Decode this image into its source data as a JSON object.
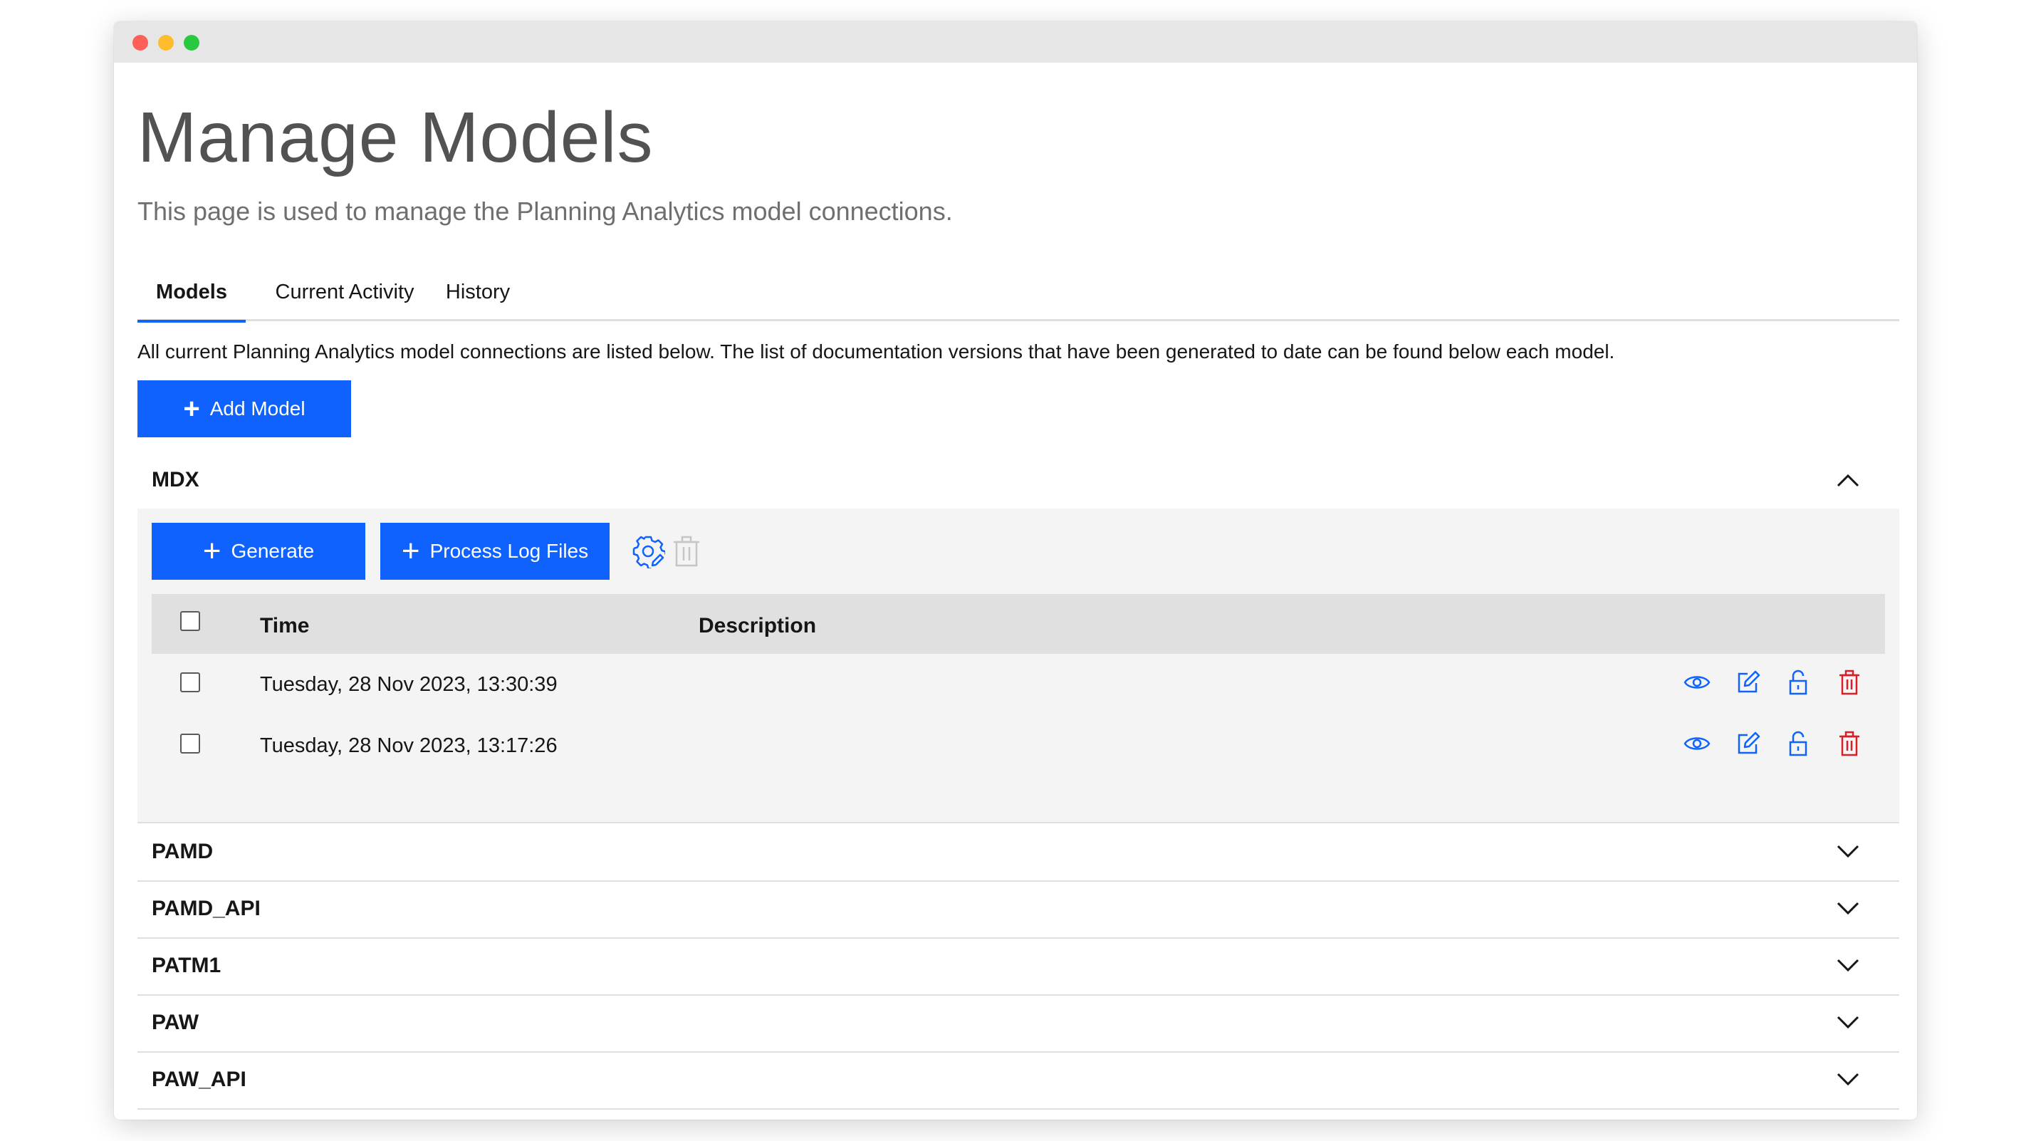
{
  "page": {
    "title": "Manage Models",
    "subtitle": "This page is used to manage the Planning Analytics model connections.",
    "intro": "All current Planning Analytics model connections are listed below. The list of documentation versions that have been generated to date can be found below each model."
  },
  "tabs": [
    {
      "label": "Models",
      "active": true
    },
    {
      "label": "Current Activity",
      "active": false
    },
    {
      "label": "History",
      "active": false
    }
  ],
  "buttons": {
    "add_model": "Add Model",
    "generate": "Generate",
    "process_log_files": "Process Log Files"
  },
  "models": [
    {
      "name": "MDX",
      "expanded": true,
      "table": {
        "headers": {
          "time": "Time",
          "description": "Description"
        },
        "rows": [
          {
            "time": "Tuesday, 28 Nov 2023, 13:30:39",
            "description": ""
          },
          {
            "time": "Tuesday, 28 Nov 2023, 13:17:26",
            "description": ""
          }
        ],
        "row_actions": [
          "eye-icon",
          "edit-icon",
          "unlock-icon",
          "trash-icon"
        ]
      }
    },
    {
      "name": "PAMD",
      "expanded": false
    },
    {
      "name": "PAMD_API",
      "expanded": false
    },
    {
      "name": "PATM1",
      "expanded": false
    },
    {
      "name": "PAW",
      "expanded": false
    },
    {
      "name": "PAW_API",
      "expanded": false
    }
  ],
  "colors": {
    "primary": "#0f62fe",
    "danger": "#da1e28",
    "disabled": "#c6c6c6",
    "panel_bg": "#f4f4f4",
    "header_bg": "#e0e0e0"
  }
}
